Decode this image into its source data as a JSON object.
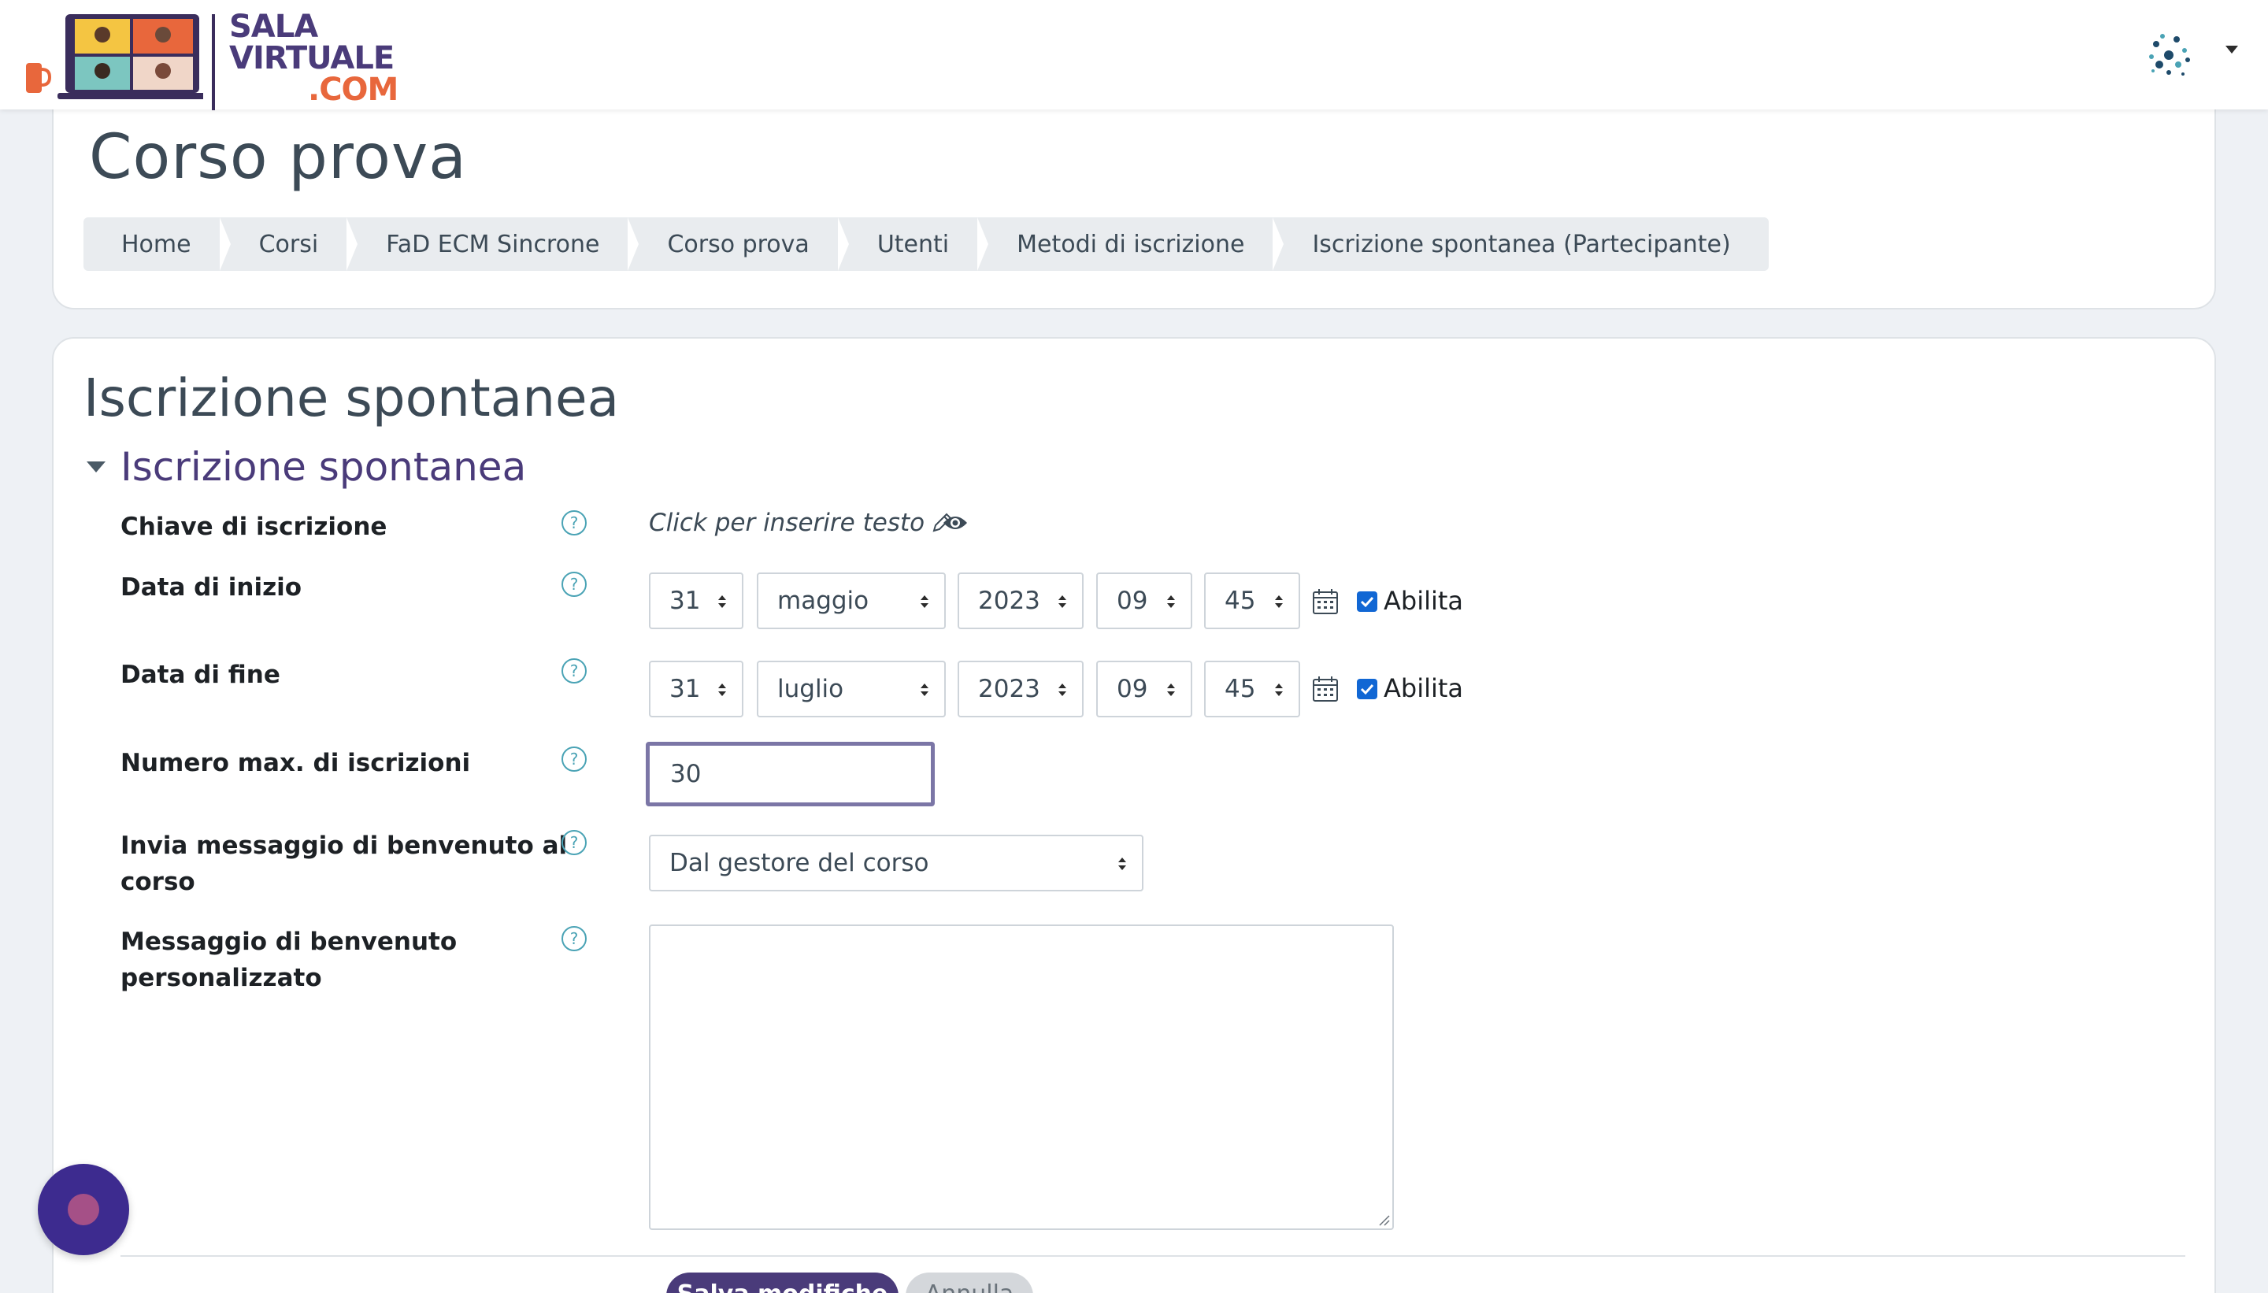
{
  "brand": {
    "line1": "SALA",
    "line2": "VIRTUALE",
    "line3": ".COM"
  },
  "page": {
    "title": "Corso prova"
  },
  "breadcrumb": [
    "Home",
    "Corsi",
    "FaD ECM Sincrone",
    "Corso prova",
    "Utenti",
    "Metodi di iscrizione",
    "Iscrizione spontanea (Partecipante)"
  ],
  "main": {
    "heading": "Iscrizione spontanea",
    "section_heading": "Iscrizione spontanea"
  },
  "form": {
    "enrolment_key": {
      "label": "Chiave di iscrizione",
      "placeholder": "Click per inserire testo"
    },
    "start_date": {
      "label": "Data di inizio",
      "day": "31",
      "month": "maggio",
      "year": "2023",
      "hour": "09",
      "minute": "45",
      "enable_label": "Abilita",
      "enabled": true
    },
    "end_date": {
      "label": "Data di fine",
      "day": "31",
      "month": "luglio",
      "year": "2023",
      "hour": "09",
      "minute": "45",
      "enable_label": "Abilita",
      "enabled": true
    },
    "max_enrolled": {
      "label": "Numero max. di iscrizioni",
      "value": "30"
    },
    "welcome_message": {
      "label_line1": "Invia messaggio di benvenuto al",
      "label_line2": "corso",
      "value": "Dal gestore del corso"
    },
    "custom_message": {
      "label_line1": "Messaggio di benvenuto",
      "label_line2": "personalizzato",
      "value": ""
    }
  },
  "buttons": {
    "save": "Salva modifiche",
    "cancel": "Annulla"
  },
  "colors": {
    "brand_purple": "#4a3b7a",
    "brand_orange": "#e8673c",
    "help_teal": "#4aa3b5",
    "check_blue": "#1167d4"
  },
  "icons": {
    "help": "question-circle-icon",
    "edit": "pencil-icon",
    "visibility": "eye-icon",
    "calendar": "calendar-icon",
    "user_menu": "user-avatar",
    "chat": "chat-widget-icon"
  }
}
